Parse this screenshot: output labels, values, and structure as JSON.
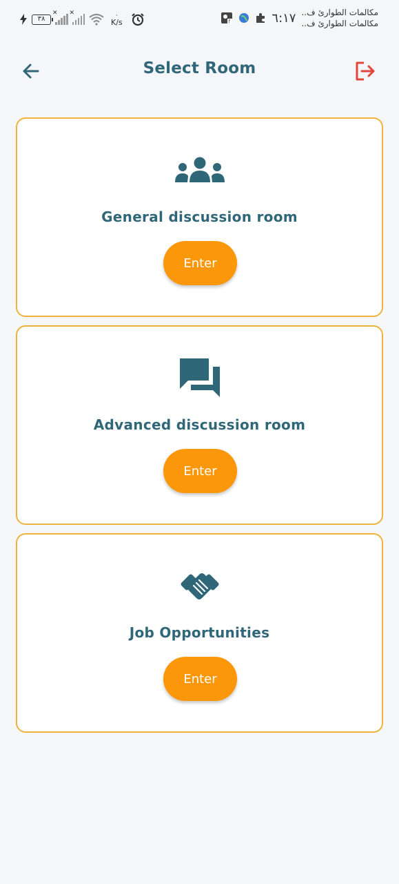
{
  "status_bar": {
    "battery": "٣٨",
    "speed_unit": "K/s",
    "time": "٦:١٧",
    "notification_line1": "مكالمات الطوارئ ف..",
    "notification_line2": "مكالمات الطوارئ ف.."
  },
  "app_bar": {
    "title": "Select Room",
    "back_icon": "arrow-left-icon",
    "logout_icon": "logout-icon"
  },
  "rooms": [
    {
      "icon": "group-icon",
      "title": "General discussion room",
      "button": "Enter"
    },
    {
      "icon": "chat-bubbles-icon",
      "title": "Advanced discussion room",
      "button": "Enter"
    },
    {
      "icon": "handshake-icon",
      "title": "Job Opportunities",
      "button": "Enter"
    }
  ],
  "colors": {
    "primary": "#2f6678",
    "accent": "#fb9708",
    "card_border": "#efb23e",
    "logout": "#e3453b",
    "background": "#f5f7f8"
  }
}
